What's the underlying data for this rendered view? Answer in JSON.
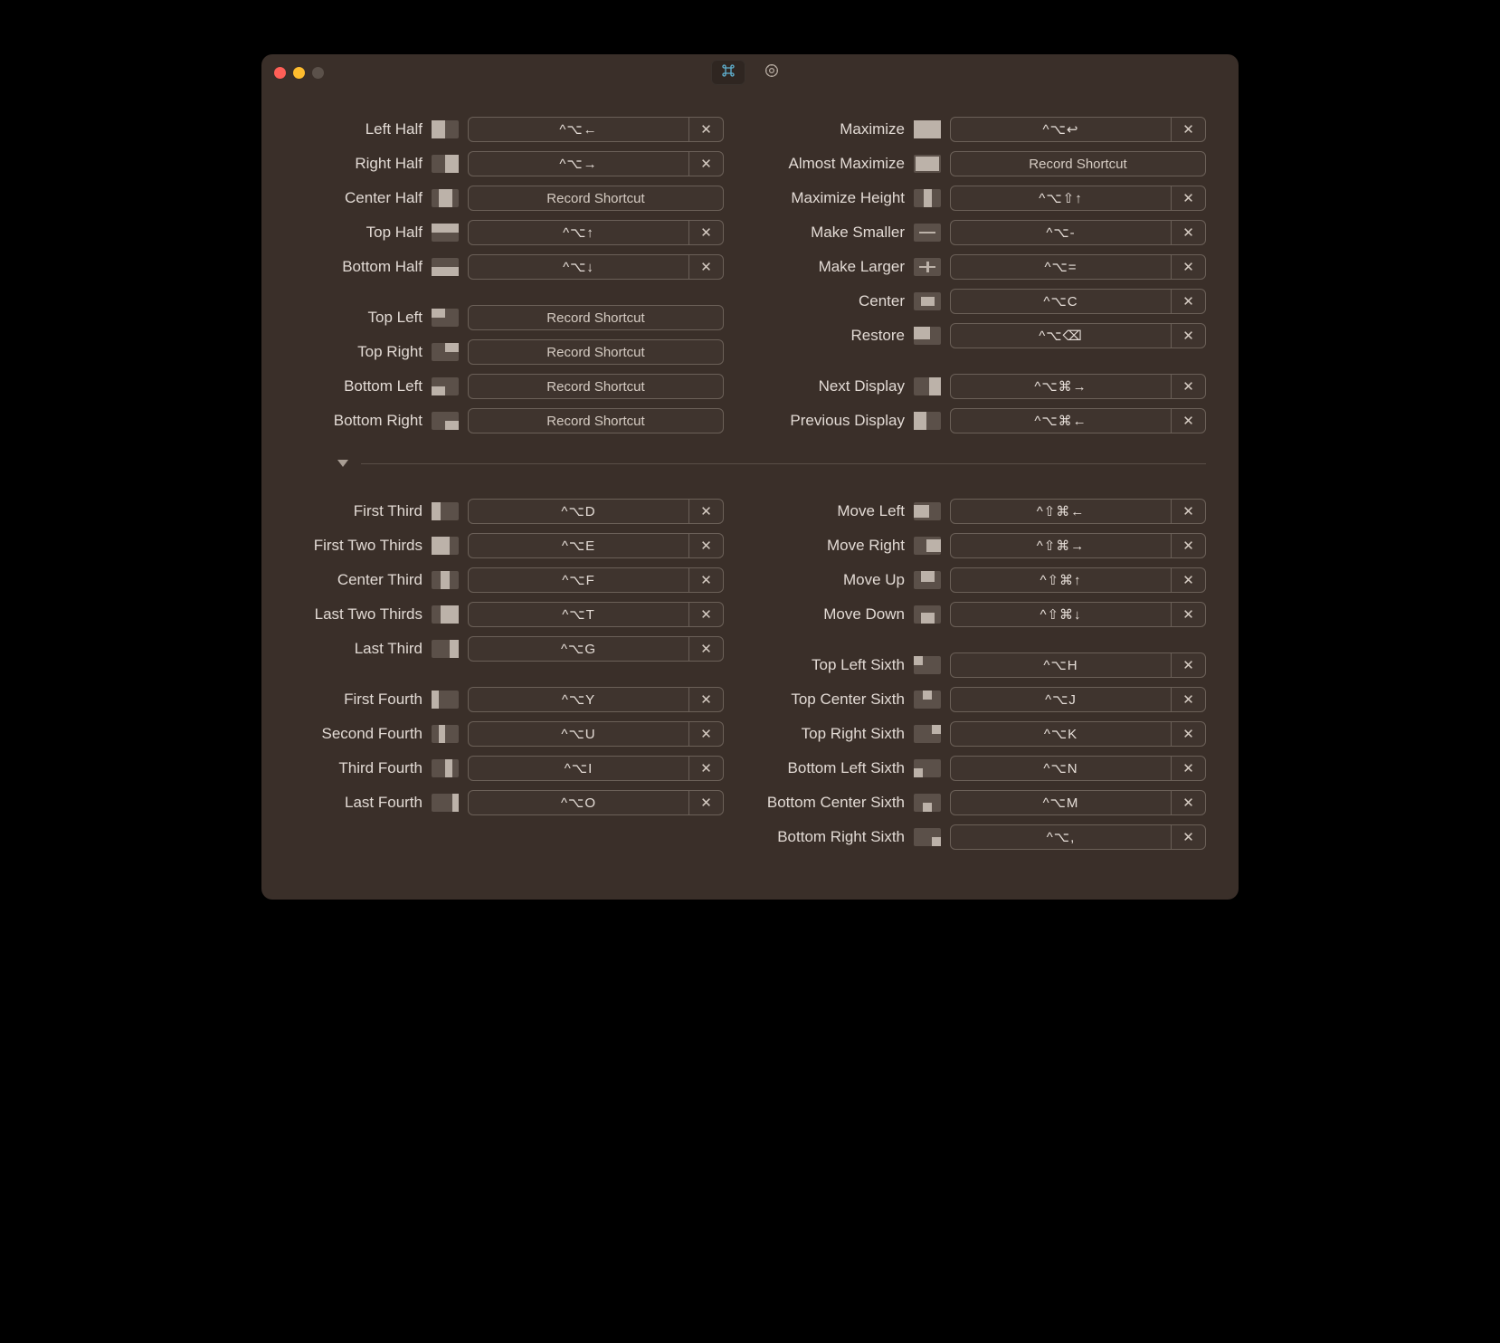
{
  "strings": {
    "record": "Record Shortcut",
    "clear": "✕"
  },
  "left": {
    "g1": [
      {
        "label": "Left Half",
        "glyph": "left-half",
        "shortcut": "^⌥←"
      },
      {
        "label": "Right Half",
        "glyph": "right-half",
        "shortcut": "^⌥→"
      },
      {
        "label": "Center Half",
        "glyph": "center-half",
        "shortcut": null
      },
      {
        "label": "Top Half",
        "glyph": "top-half",
        "shortcut": "^⌥↑"
      },
      {
        "label": "Bottom Half",
        "glyph": "bottom-half",
        "shortcut": "^⌥↓"
      }
    ],
    "g2": [
      {
        "label": "Top Left",
        "glyph": "top-left",
        "shortcut": null
      },
      {
        "label": "Top Right",
        "glyph": "top-right",
        "shortcut": null
      },
      {
        "label": "Bottom Left",
        "glyph": "bottom-left",
        "shortcut": null
      },
      {
        "label": "Bottom Right",
        "glyph": "bottom-right",
        "shortcut": null
      }
    ],
    "g3": [
      {
        "label": "First Third",
        "glyph": "first-third",
        "shortcut": "^⌥D"
      },
      {
        "label": "First Two Thirds",
        "glyph": "first-two-thirds",
        "shortcut": "^⌥E"
      },
      {
        "label": "Center Third",
        "glyph": "center-third",
        "shortcut": "^⌥F"
      },
      {
        "label": "Last Two Thirds",
        "glyph": "last-two-thirds",
        "shortcut": "^⌥T"
      },
      {
        "label": "Last Third",
        "glyph": "last-third",
        "shortcut": "^⌥G"
      }
    ],
    "g4": [
      {
        "label": "First Fourth",
        "glyph": "first-fourth",
        "shortcut": "^⌥Y"
      },
      {
        "label": "Second Fourth",
        "glyph": "second-fourth",
        "shortcut": "^⌥U"
      },
      {
        "label": "Third Fourth",
        "glyph": "third-fourth",
        "shortcut": "^⌥I"
      },
      {
        "label": "Last Fourth",
        "glyph": "last-fourth",
        "shortcut": "^⌥O"
      }
    ]
  },
  "right": {
    "g1": [
      {
        "label": "Maximize",
        "glyph": "maximize",
        "shortcut": "^⌥↩"
      },
      {
        "label": "Almost Maximize",
        "glyph": "almost-maximize",
        "shortcut": null
      },
      {
        "label": "Maximize Height",
        "glyph": "maximize-height",
        "shortcut": "^⌥⇧↑"
      },
      {
        "label": "Make Smaller",
        "glyph": "make-smaller",
        "shortcut": "^⌥-"
      },
      {
        "label": "Make Larger",
        "glyph": "make-larger",
        "shortcut": "^⌥="
      },
      {
        "label": "Center",
        "glyph": "center",
        "shortcut": "^⌥C"
      },
      {
        "label": "Restore",
        "glyph": "restore",
        "shortcut": "^⌥⌫"
      }
    ],
    "g2": [
      {
        "label": "Next Display",
        "glyph": "next-display",
        "shortcut": "^⌥⌘→"
      },
      {
        "label": "Previous Display",
        "glyph": "previous-display",
        "shortcut": "^⌥⌘←"
      }
    ],
    "g3": [
      {
        "label": "Move Left",
        "glyph": "move-left",
        "shortcut": "^⇧⌘←"
      },
      {
        "label": "Move Right",
        "glyph": "move-right",
        "shortcut": "^⇧⌘→"
      },
      {
        "label": "Move Up",
        "glyph": "move-up",
        "shortcut": "^⇧⌘↑"
      },
      {
        "label": "Move Down",
        "glyph": "move-down",
        "shortcut": "^⇧⌘↓"
      }
    ],
    "g4": [
      {
        "label": "Top Left Sixth",
        "glyph": "tl-sixth",
        "shortcut": "^⌥H"
      },
      {
        "label": "Top Center Sixth",
        "glyph": "tc-sixth",
        "shortcut": "^⌥J"
      },
      {
        "label": "Top Right Sixth",
        "glyph": "tr-sixth",
        "shortcut": "^⌥K"
      },
      {
        "label": "Bottom Left Sixth",
        "glyph": "bl-sixth",
        "shortcut": "^⌥N"
      },
      {
        "label": "Bottom Center Sixth",
        "glyph": "bc-sixth",
        "shortcut": "^⌥M"
      },
      {
        "label": "Bottom Right Sixth",
        "glyph": "br-sixth",
        "shortcut": "^⌥,"
      }
    ]
  }
}
